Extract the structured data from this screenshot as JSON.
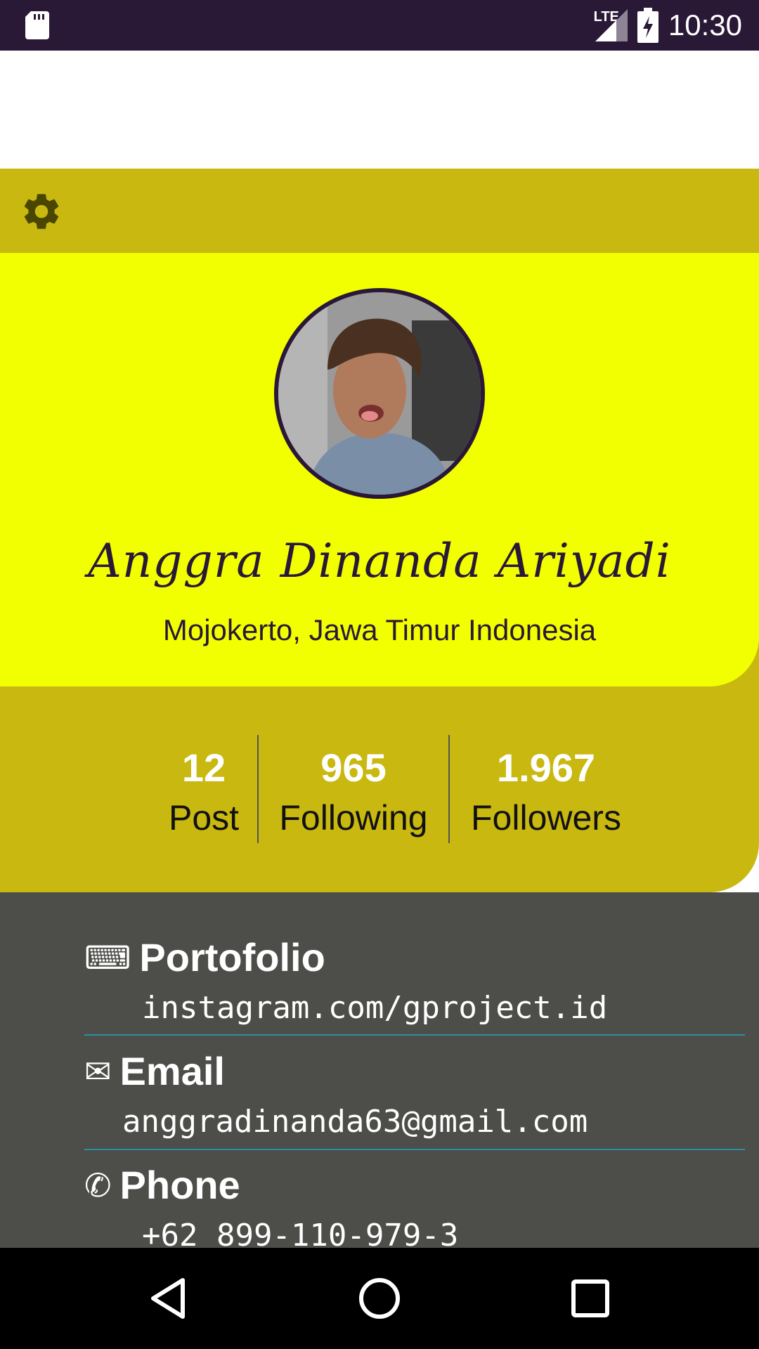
{
  "status_bar": {
    "time": "10:30",
    "network": "LTE"
  },
  "profile": {
    "name": "Anggra Dinanda Ariyadi",
    "location": "Mojokerto, Jawa Timur Indonesia"
  },
  "stats": [
    {
      "value": "12",
      "label": "Post"
    },
    {
      "value": "965",
      "label": "Following"
    },
    {
      "value": "1.967",
      "label": "Followers"
    }
  ],
  "info": [
    {
      "icon": "keyboard-icon",
      "glyph": "⌨",
      "title": "Portofolio",
      "value": "instagram.com/gproject.id"
    },
    {
      "icon": "envelope-icon",
      "glyph": "✉",
      "title": "Email",
      "value": "anggradinanda63@gmail.com"
    },
    {
      "icon": "phone-icon",
      "glyph": "✆",
      "title": "Phone",
      "value": "+62 899-110-979-3"
    }
  ],
  "colors": {
    "status_bar": "#2a1837",
    "toolbar": "#c8b810",
    "header": "#f2ff00",
    "info_background": "#4d4d4a",
    "divider": "#2c8fa0"
  }
}
